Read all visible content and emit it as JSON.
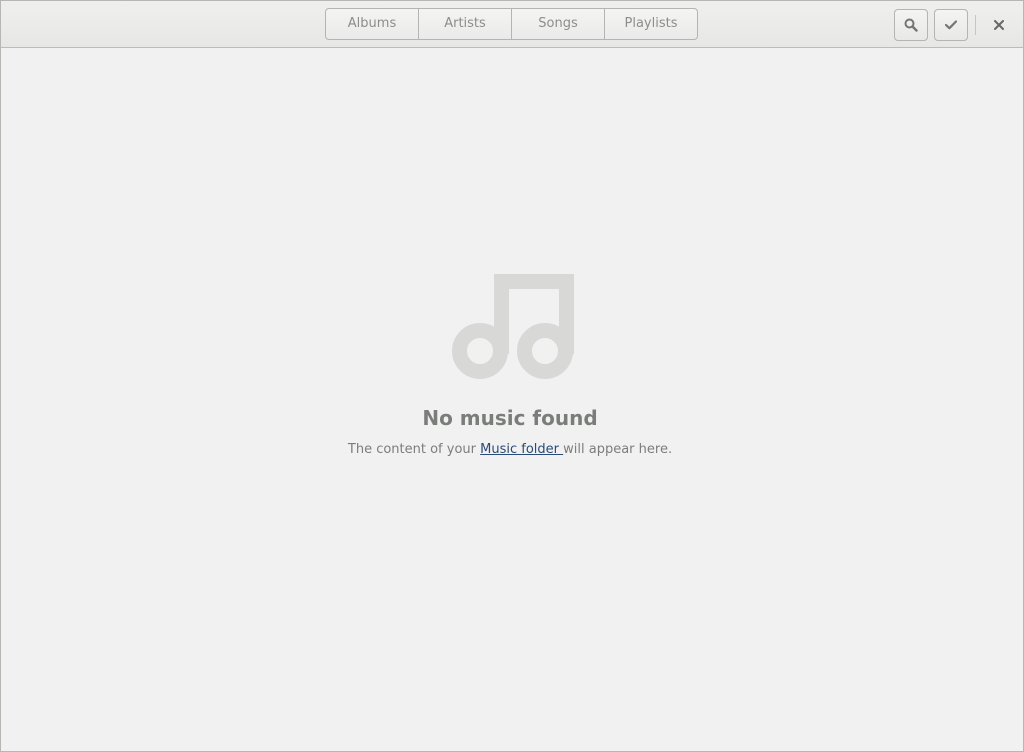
{
  "header": {
    "view_switcher": {
      "tabs": [
        {
          "label": "Albums"
        },
        {
          "label": "Artists"
        },
        {
          "label": "Songs"
        },
        {
          "label": "Playlists"
        }
      ]
    },
    "buttons": {
      "search_icon": "search-icon",
      "select_icon": "checkmark-icon",
      "close_icon": "close-icon"
    }
  },
  "main": {
    "empty_state": {
      "icon": "music-note-icon",
      "title": "No music found",
      "description_before": "The content of your ",
      "link_text": "Music folder ",
      "description_after": "will appear here."
    }
  },
  "colors": {
    "background": "#f1f1f1",
    "link": "#2a4b78",
    "icon": "#d8d8d7",
    "text": "#7b7e7b"
  }
}
